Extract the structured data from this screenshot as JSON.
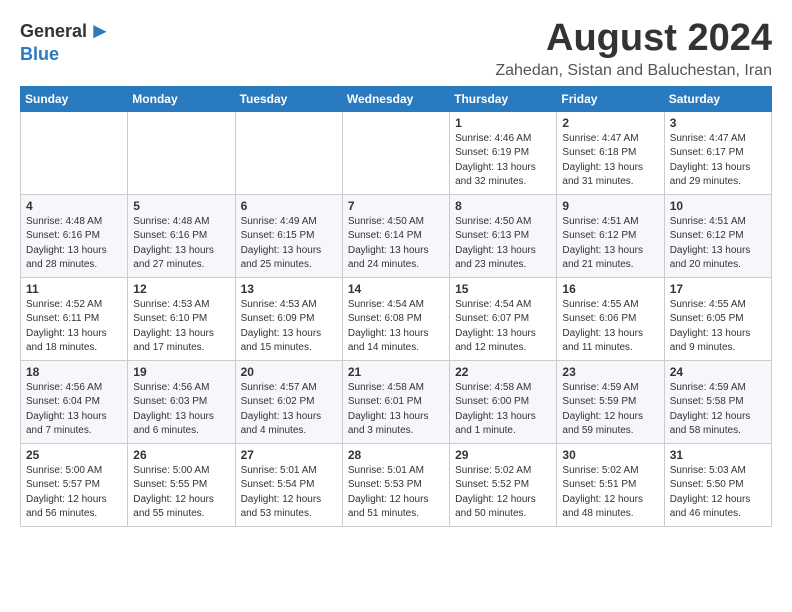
{
  "logo": {
    "general": "General",
    "blue": "Blue"
  },
  "title": "August 2024",
  "subtitle": "Zahedan, Sistan and Baluchestan, Iran",
  "headers": [
    "Sunday",
    "Monday",
    "Tuesday",
    "Wednesday",
    "Thursday",
    "Friday",
    "Saturday"
  ],
  "weeks": [
    {
      "days": [
        {
          "num": "",
          "info": ""
        },
        {
          "num": "",
          "info": ""
        },
        {
          "num": "",
          "info": ""
        },
        {
          "num": "",
          "info": ""
        },
        {
          "num": "1",
          "info": "Sunrise: 4:46 AM\nSunset: 6:19 PM\nDaylight: 13 hours\nand 32 minutes."
        },
        {
          "num": "2",
          "info": "Sunrise: 4:47 AM\nSunset: 6:18 PM\nDaylight: 13 hours\nand 31 minutes."
        },
        {
          "num": "3",
          "info": "Sunrise: 4:47 AM\nSunset: 6:17 PM\nDaylight: 13 hours\nand 29 minutes."
        }
      ]
    },
    {
      "days": [
        {
          "num": "4",
          "info": "Sunrise: 4:48 AM\nSunset: 6:16 PM\nDaylight: 13 hours\nand 28 minutes."
        },
        {
          "num": "5",
          "info": "Sunrise: 4:48 AM\nSunset: 6:16 PM\nDaylight: 13 hours\nand 27 minutes."
        },
        {
          "num": "6",
          "info": "Sunrise: 4:49 AM\nSunset: 6:15 PM\nDaylight: 13 hours\nand 25 minutes."
        },
        {
          "num": "7",
          "info": "Sunrise: 4:50 AM\nSunset: 6:14 PM\nDaylight: 13 hours\nand 24 minutes."
        },
        {
          "num": "8",
          "info": "Sunrise: 4:50 AM\nSunset: 6:13 PM\nDaylight: 13 hours\nand 23 minutes."
        },
        {
          "num": "9",
          "info": "Sunrise: 4:51 AM\nSunset: 6:12 PM\nDaylight: 13 hours\nand 21 minutes."
        },
        {
          "num": "10",
          "info": "Sunrise: 4:51 AM\nSunset: 6:12 PM\nDaylight: 13 hours\nand 20 minutes."
        }
      ]
    },
    {
      "days": [
        {
          "num": "11",
          "info": "Sunrise: 4:52 AM\nSunset: 6:11 PM\nDaylight: 13 hours\nand 18 minutes."
        },
        {
          "num": "12",
          "info": "Sunrise: 4:53 AM\nSunset: 6:10 PM\nDaylight: 13 hours\nand 17 minutes."
        },
        {
          "num": "13",
          "info": "Sunrise: 4:53 AM\nSunset: 6:09 PM\nDaylight: 13 hours\nand 15 minutes."
        },
        {
          "num": "14",
          "info": "Sunrise: 4:54 AM\nSunset: 6:08 PM\nDaylight: 13 hours\nand 14 minutes."
        },
        {
          "num": "15",
          "info": "Sunrise: 4:54 AM\nSunset: 6:07 PM\nDaylight: 13 hours\nand 12 minutes."
        },
        {
          "num": "16",
          "info": "Sunrise: 4:55 AM\nSunset: 6:06 PM\nDaylight: 13 hours\nand 11 minutes."
        },
        {
          "num": "17",
          "info": "Sunrise: 4:55 AM\nSunset: 6:05 PM\nDaylight: 13 hours\nand 9 minutes."
        }
      ]
    },
    {
      "days": [
        {
          "num": "18",
          "info": "Sunrise: 4:56 AM\nSunset: 6:04 PM\nDaylight: 13 hours\nand 7 minutes."
        },
        {
          "num": "19",
          "info": "Sunrise: 4:56 AM\nSunset: 6:03 PM\nDaylight: 13 hours\nand 6 minutes."
        },
        {
          "num": "20",
          "info": "Sunrise: 4:57 AM\nSunset: 6:02 PM\nDaylight: 13 hours\nand 4 minutes."
        },
        {
          "num": "21",
          "info": "Sunrise: 4:58 AM\nSunset: 6:01 PM\nDaylight: 13 hours\nand 3 minutes."
        },
        {
          "num": "22",
          "info": "Sunrise: 4:58 AM\nSunset: 6:00 PM\nDaylight: 13 hours\nand 1 minute."
        },
        {
          "num": "23",
          "info": "Sunrise: 4:59 AM\nSunset: 5:59 PM\nDaylight: 12 hours\nand 59 minutes."
        },
        {
          "num": "24",
          "info": "Sunrise: 4:59 AM\nSunset: 5:58 PM\nDaylight: 12 hours\nand 58 minutes."
        }
      ]
    },
    {
      "days": [
        {
          "num": "25",
          "info": "Sunrise: 5:00 AM\nSunset: 5:57 PM\nDaylight: 12 hours\nand 56 minutes."
        },
        {
          "num": "26",
          "info": "Sunrise: 5:00 AM\nSunset: 5:55 PM\nDaylight: 12 hours\nand 55 minutes."
        },
        {
          "num": "27",
          "info": "Sunrise: 5:01 AM\nSunset: 5:54 PM\nDaylight: 12 hours\nand 53 minutes."
        },
        {
          "num": "28",
          "info": "Sunrise: 5:01 AM\nSunset: 5:53 PM\nDaylight: 12 hours\nand 51 minutes."
        },
        {
          "num": "29",
          "info": "Sunrise: 5:02 AM\nSunset: 5:52 PM\nDaylight: 12 hours\nand 50 minutes."
        },
        {
          "num": "30",
          "info": "Sunrise: 5:02 AM\nSunset: 5:51 PM\nDaylight: 12 hours\nand 48 minutes."
        },
        {
          "num": "31",
          "info": "Sunrise: 5:03 AM\nSunset: 5:50 PM\nDaylight: 12 hours\nand 46 minutes."
        }
      ]
    }
  ]
}
